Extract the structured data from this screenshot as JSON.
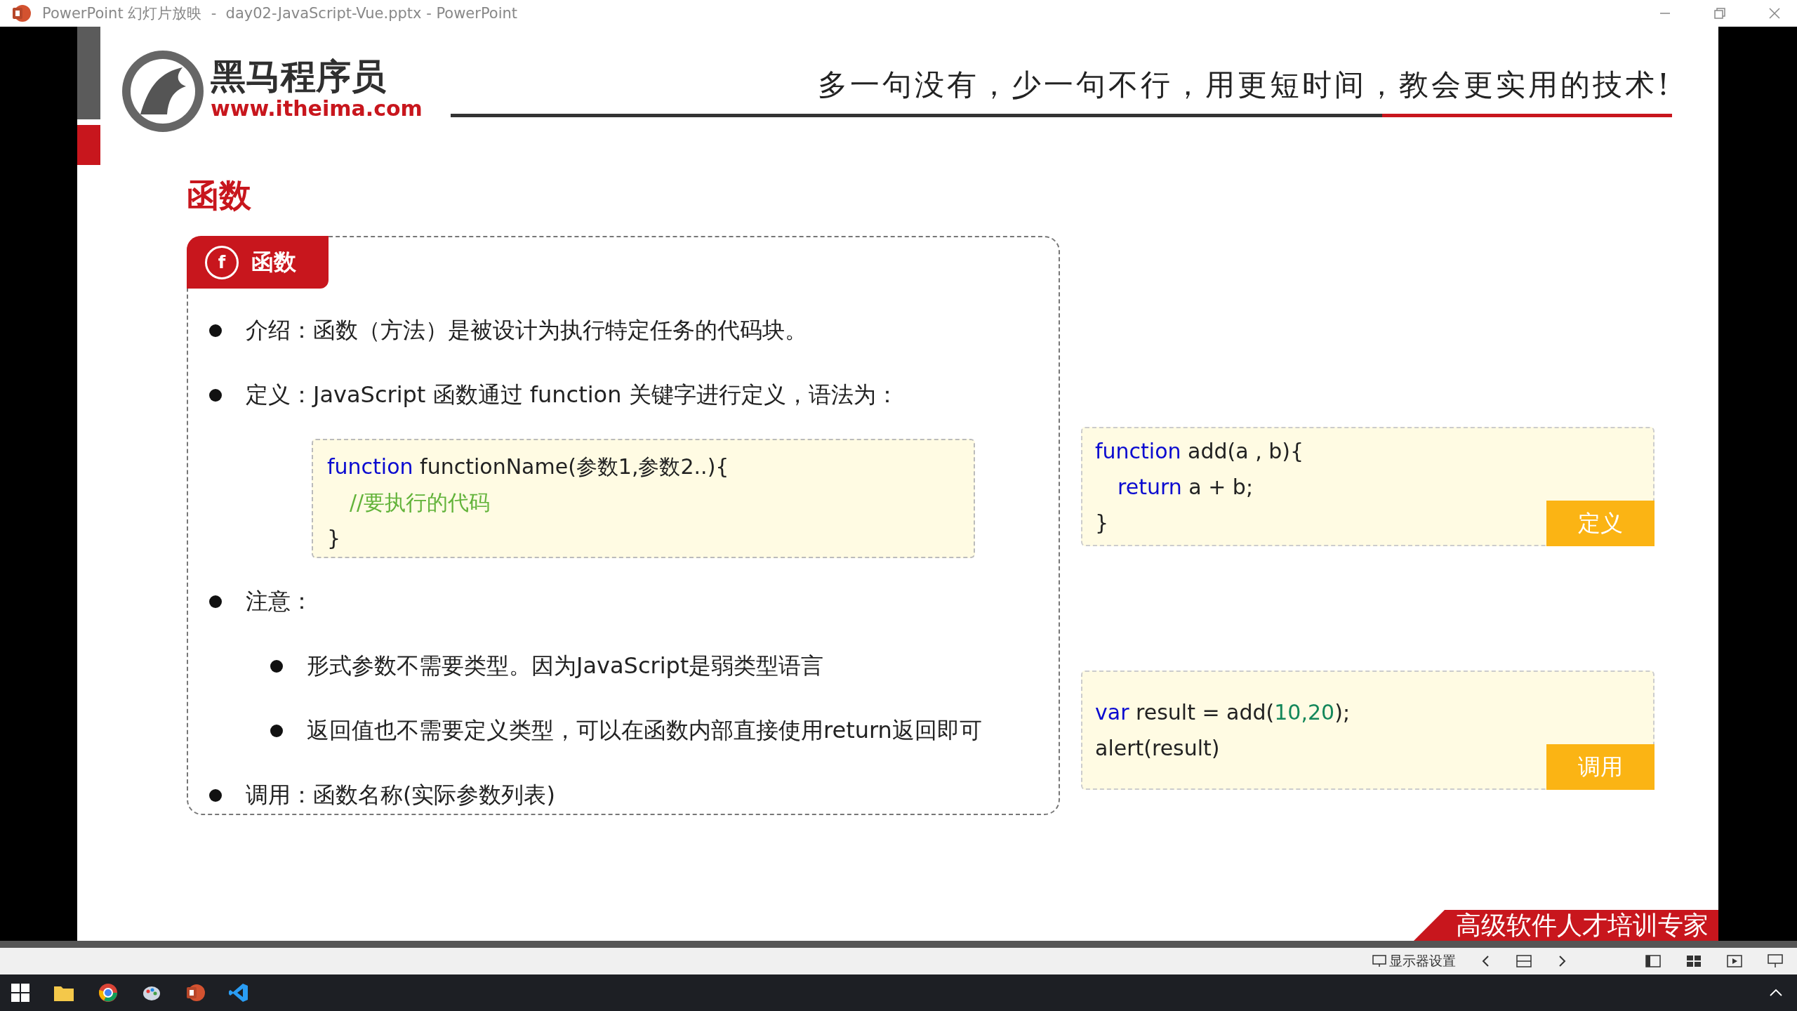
{
  "window": {
    "title": "PowerPoint 幻灯片放映  -  day02-JavaScript-Vue.pptx - PowerPoint"
  },
  "slide": {
    "logo": {
      "name": "黑马程序员",
      "url": "www.itheima.com"
    },
    "slogan": "多一句没有，少一句不行，用更短时间，教会更实用的技术!",
    "heading": "函数",
    "card": {
      "tab_icon": "f",
      "tab": "函数",
      "items": [
        {
          "kind": "bullet",
          "text": "介绍：函数（方法）是被设计为执行特定任务的代码块。"
        },
        {
          "kind": "bullet",
          "text": "定义：JavaScript 函数通过 function 关键字进行定义，语法为："
        },
        {
          "kind": "code",
          "lines": [
            {
              "indent": false,
              "tokens": [
                {
                  "kind": "keyword",
                  "text": "function"
                },
                {
                  "kind": "plain",
                  "text": " functionName(参数1,参数2..){"
                }
              ]
            },
            {
              "indent": true,
              "tokens": [
                {
                  "kind": "comment",
                  "text": "//要执行的代码"
                }
              ]
            },
            {
              "indent": false,
              "tokens": [
                {
                  "kind": "plain",
                  "text": "}"
                }
              ]
            }
          ]
        },
        {
          "kind": "bullet",
          "text": "注意："
        },
        {
          "kind": "sub_bullet",
          "text": "形式参数不需要类型。因为JavaScript是弱类型语言"
        },
        {
          "kind": "sub_bullet",
          "text": "返回值也不需要定义类型，可以在函数内部直接使用return返回即可"
        },
        {
          "kind": "bullet",
          "text": "调用：函数名称(实际参数列表)"
        }
      ]
    },
    "examples": [
      {
        "tag": "定义",
        "lines": [
          {
            "indent": false,
            "tokens": [
              {
                "kind": "keyword",
                "text": "function"
              },
              {
                "kind": "plain",
                "text": " add(a , b){"
              }
            ]
          },
          {
            "indent": true,
            "tokens": [
              {
                "kind": "keyword",
                "text": "return"
              },
              {
                "kind": "plain",
                "text": " a + b;"
              }
            ]
          },
          {
            "indent": false,
            "tokens": [
              {
                "kind": "plain",
                "text": "}"
              }
            ]
          }
        ]
      },
      {
        "tag": "调用",
        "lines": [
          {
            "indent": false,
            "tokens": [
              {
                "kind": "keyword",
                "text": "var"
              },
              {
                "kind": "plain",
                "text": " result = add("
              },
              {
                "kind": "number",
                "text": "10,20"
              },
              {
                "kind": "plain",
                "text": ");"
              }
            ]
          },
          {
            "indent": false,
            "tokens": [
              {
                "kind": "plain",
                "text": "alert(result)"
              }
            ]
          }
        ]
      }
    ],
    "banner": "高级软件人才培训专家"
  },
  "status_bar": {
    "display_settings": "显示器设置"
  }
}
